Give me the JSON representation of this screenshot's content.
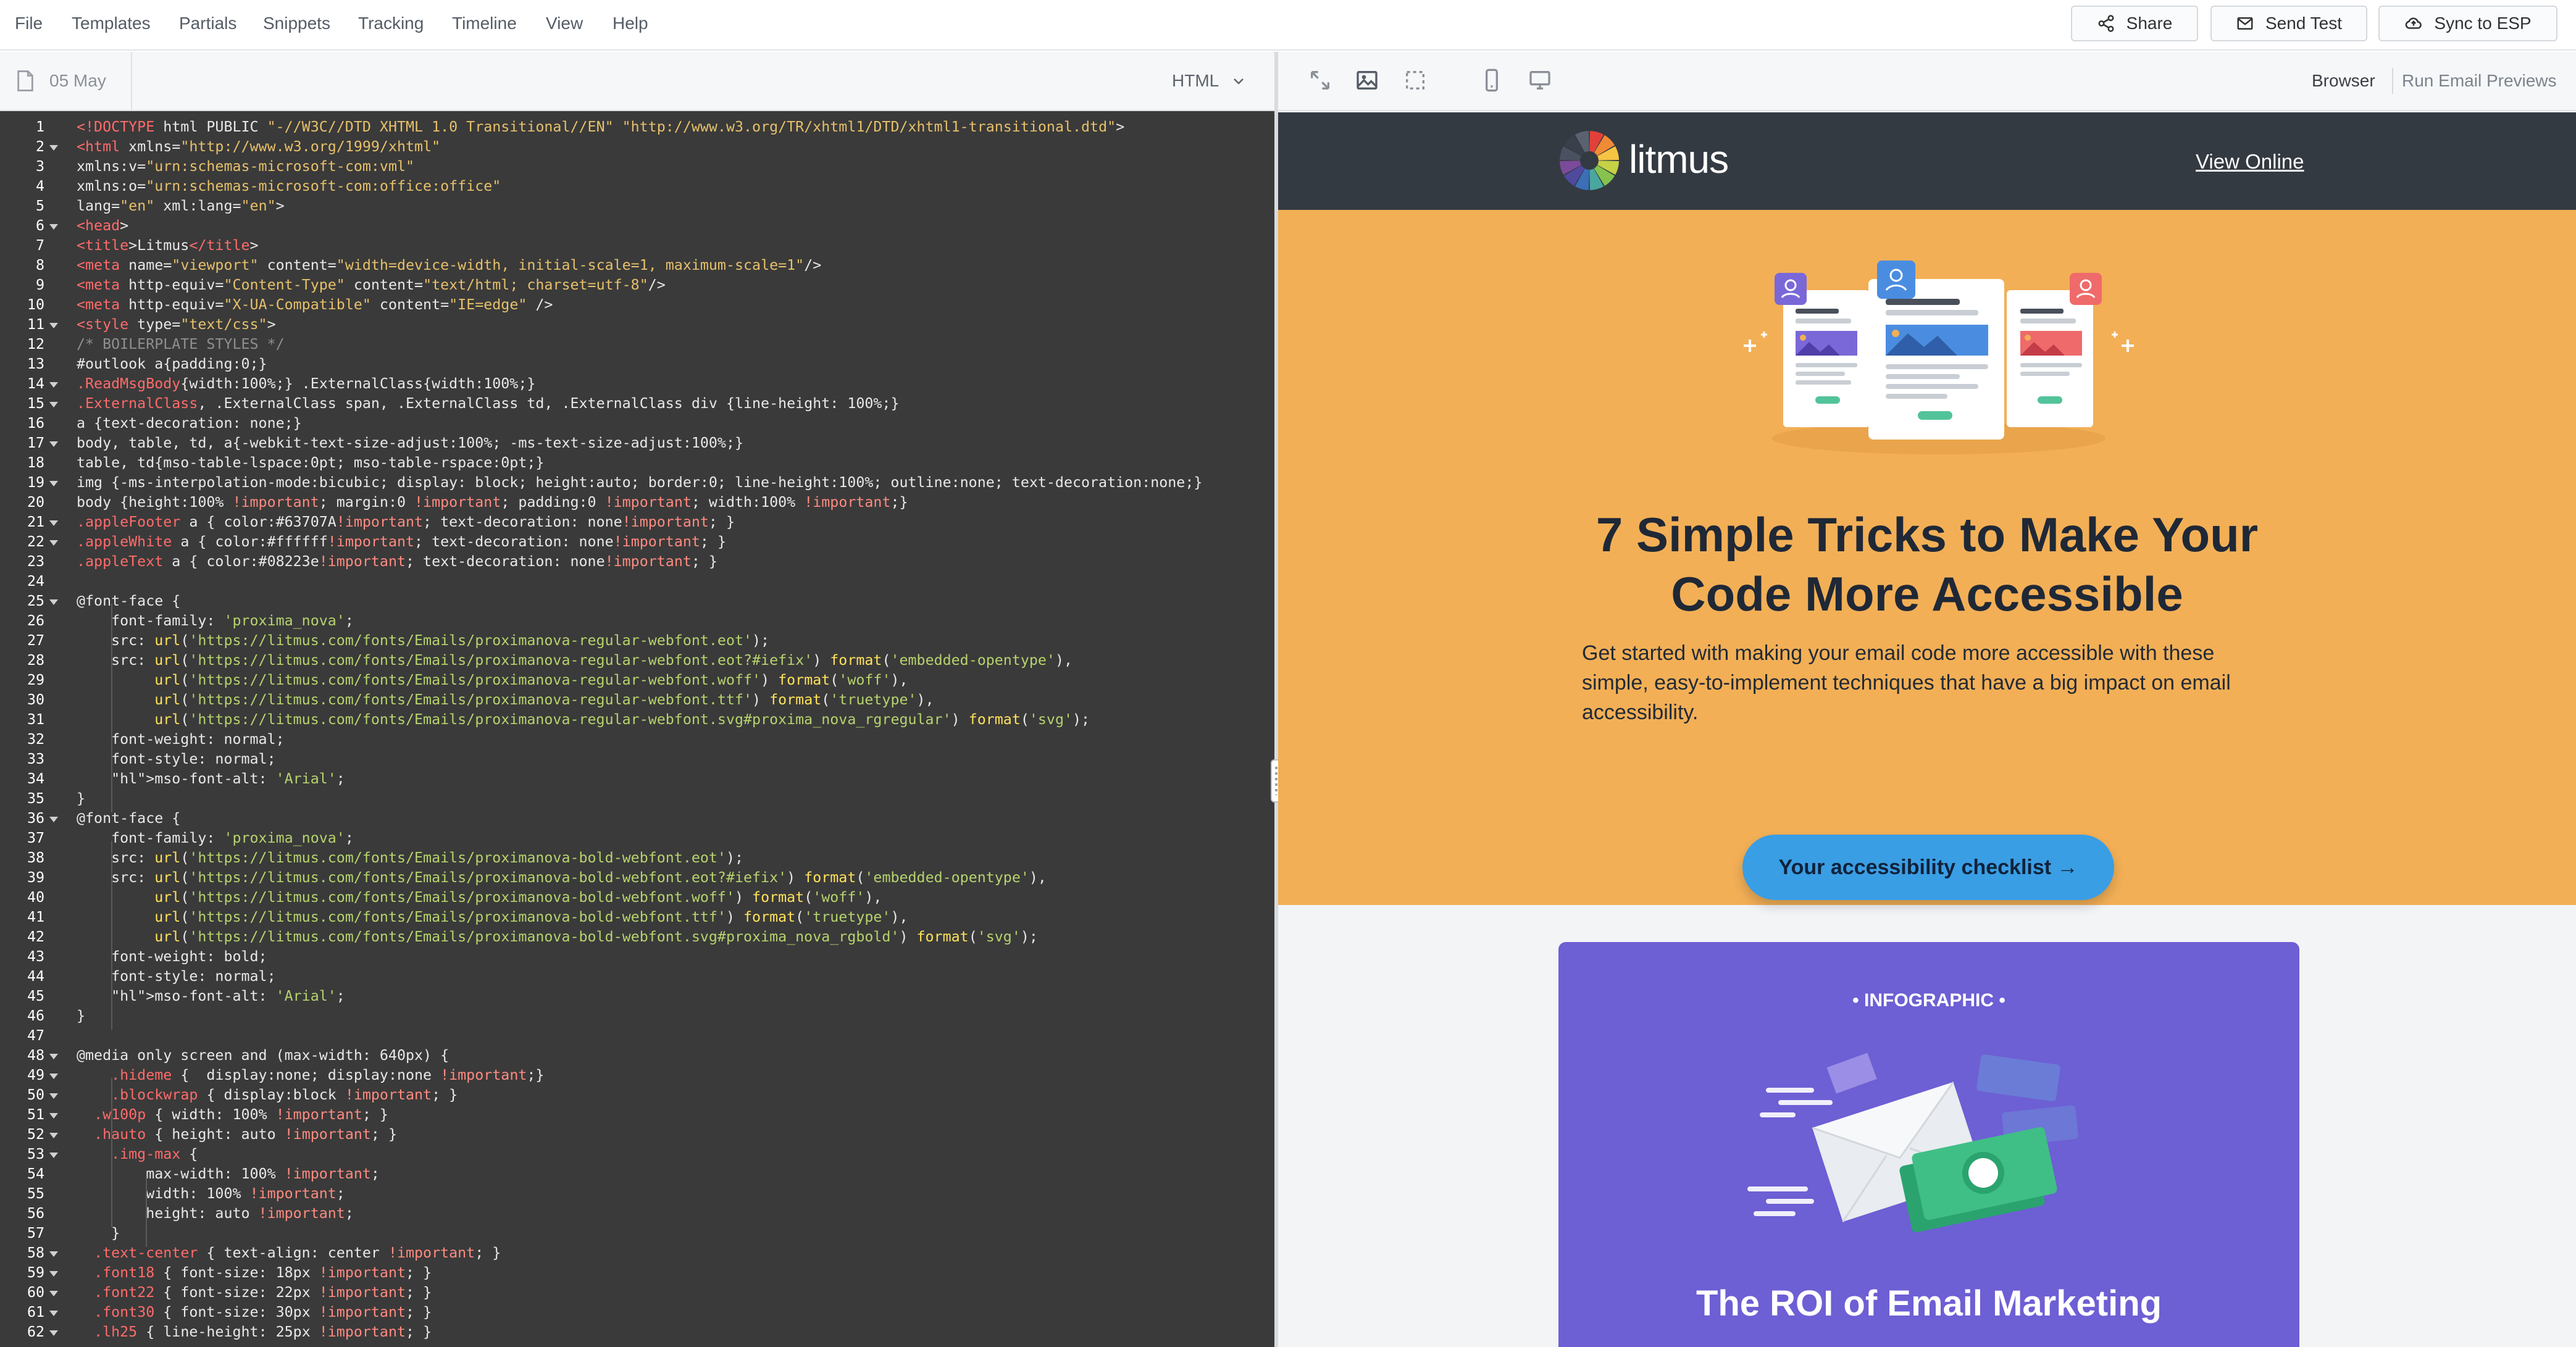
{
  "menu": {
    "items": [
      "File",
      "Templates",
      "Partials",
      "Snippets",
      "Tracking",
      "Timeline",
      "View",
      "Help"
    ],
    "share_label": "Share",
    "send_test_label": "Send Test",
    "sync_label": "Sync to ESP"
  },
  "editor": {
    "tab_date": "05 May",
    "language": "HTML"
  },
  "preview": {
    "tab_browser": "Browser",
    "tab_previews": "Run Email Previews"
  },
  "email": {
    "logo_text": "litmus",
    "view_online": "View Online",
    "hero_title_line1": "7 Simple Tricks to Make Your",
    "hero_title_line2": "Code More Accessible",
    "hero_body_line1": "Get started with making your email code more accessible with these",
    "hero_body_line2": "simple, easy-to-implement techniques that have a big impact on email",
    "hero_body_line3": "accessibility.",
    "cta_label": "Your accessibility checklist →",
    "info_eyebrow": "• INFOGRAPHIC •",
    "info_title": "The ROI of Email Marketing"
  },
  "colors": {
    "editor_bg": "#3a3a3a",
    "hero_bg": "#f2af56",
    "header_bg": "#343a42",
    "infographic_bg": "#6d5fd4",
    "cta_bg": "#3a9ee4",
    "highlight": "#e23a72"
  },
  "code": {
    "line_numbers": [
      "1",
      "2",
      "3",
      "4",
      "5",
      "6",
      "7",
      "8",
      "9",
      "10",
      "11",
      "12",
      "13",
      "14",
      "15",
      "16",
      "17",
      "18",
      "19",
      "20",
      "21",
      "22",
      "23",
      "24",
      "25",
      "26",
      "27",
      "28",
      "29",
      "30",
      "31",
      "32",
      "33",
      "34",
      "35",
      "36",
      "37",
      "38",
      "39",
      "40",
      "41",
      "42",
      "43",
      "44",
      "45",
      "46",
      "47",
      "48",
      "49",
      "50",
      "51",
      "52",
      "53",
      "54",
      "55",
      "56",
      "57",
      "58",
      "59",
      "60",
      "61",
      "62"
    ],
    "lines": [
      "<!DOCTYPE html PUBLIC \"-//W3C//DTD XHTML 1.0 Transitional//EN\" \"http://www.w3.org/TR/xhtml1/DTD/xhtml1-transitional.dtd\">",
      "<html xmlns=\"http://www.w3.org/1999/xhtml\"",
      "xmlns:v=\"urn:schemas-microsoft-com:vml\"",
      "xmlns:o=\"urn:schemas-microsoft-com:office:office\"",
      "lang=\"en\" xml:lang=\"en\">",
      "<head>",
      "<title>Litmus</title>",
      "<meta name=\"viewport\" content=\"width=device-width, initial-scale=1, maximum-scale=1\"/>",
      "<meta http-equiv=\"Content-Type\" content=\"text/html; charset=utf-8\"/>",
      "<meta http-equiv=\"X-UA-Compatible\" content=\"IE=edge\" />",
      "<style type=\"text/css\">",
      "/* BOILERPLATE STYLES */",
      "#outlook a{padding:0;}",
      ".ReadMsgBody{width:100%;} .ExternalClass{width:100%;}",
      ".ExternalClass, .ExternalClass span, .ExternalClass td, .ExternalClass div {line-height: 100%;}",
      "a {text-decoration: none;}",
      "body, table, td, a{-webkit-text-size-adjust:100%; -ms-text-size-adjust:100%;}",
      "table, td{mso-table-lspace:0pt; mso-table-rspace:0pt;}",
      "img {-ms-interpolation-mode:bicubic; display: block; height:auto; border:0; line-height:100%; outline:none; text-decoration:none;}",
      "body {height:100% !important; margin:0 !important; padding:0 !important; width:100% !important;}",
      ".appleFooter a { color:#63707A!important; text-decoration: none!important; }",
      ".appleWhite a { color:#ffffff!important; text-decoration: none!important; }",
      ".appleText a { color:#08223e!important; text-decoration: none!important; }",
      "",
      "@font-face {",
      "    font-family: 'proxima_nova';",
      "    src: url('https://litmus.com/fonts/Emails/proximanova-regular-webfont.eot');",
      "    src: url('https://litmus.com/fonts/Emails/proximanova-regular-webfont.eot?#iefix') format('embedded-opentype'),",
      "         url('https://litmus.com/fonts/Emails/proximanova-regular-webfont.woff') format('woff'),",
      "         url('https://litmus.com/fonts/Emails/proximanova-regular-webfont.ttf') format('truetype'),",
      "         url('https://litmus.com/fonts/Emails/proximanova-regular-webfont.svg#proxima_nova_rgregular') format('svg');",
      "    font-weight: normal;",
      "    font-style: normal;",
      "    mso-font-alt: 'Arial';",
      "}",
      "@font-face {",
      "    font-family: 'proxima_nova';",
      "    src: url('https://litmus.com/fonts/Emails/proximanova-bold-webfont.eot');",
      "    src: url('https://litmus.com/fonts/Emails/proximanova-bold-webfont.eot?#iefix') format('embedded-opentype'),",
      "         url('https://litmus.com/fonts/Emails/proximanova-bold-webfont.woff') format('woff'),",
      "         url('https://litmus.com/fonts/Emails/proximanova-bold-webfont.ttf') format('truetype'),",
      "         url('https://litmus.com/fonts/Emails/proximanova-bold-webfont.svg#proxima_nova_rgbold') format('svg');",
      "    font-weight: bold;",
      "    font-style: normal;",
      "    mso-font-alt: 'Arial';",
      "}",
      "",
      "@media only screen and (max-width: 640px) {",
      "    .hideme {  display:none; display:none !important;}",
      "    .blockwrap { display:block !important; }",
      "  .w100p { width: 100% !important; }",
      "  .hauto { height: auto !important; }",
      "    .img-max {",
      "        max-width: 100% !important;",
      "        width: 100% !important;",
      "        height: auto !important;",
      "    }",
      "  .text-center { text-align: center !important; }",
      "  .font18 { font-size: 18px !important; }",
      "  .font22 { font-size: 22px !important; }",
      "  .font30 { font-size: 30px !important; }",
      "  .lh25 { line-height: 25px !important; }"
    ],
    "fold_lines": [
      2,
      6,
      11,
      14,
      15,
      17,
      19,
      21,
      22,
      25,
      36,
      48,
      49,
      50,
      51,
      52,
      53,
      58,
      59,
      60,
      61,
      62
    ]
  }
}
